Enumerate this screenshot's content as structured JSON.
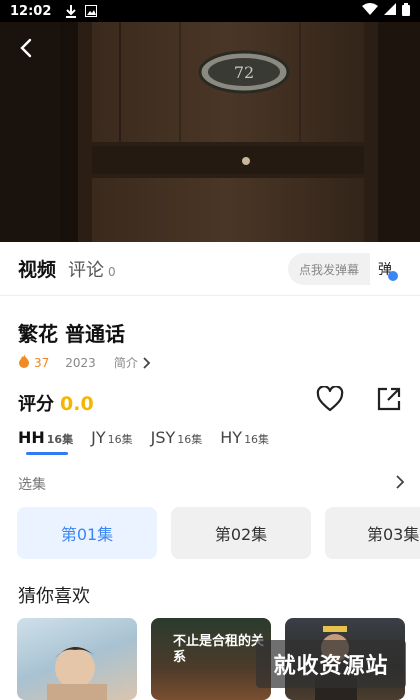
{
  "status_bar": {
    "time": "12:02"
  },
  "video": {
    "door_number": "72"
  },
  "tabs": {
    "video_label": "视频",
    "comments_label": "评论",
    "comments_count": "0",
    "danmu_placeholder": "点我发弹幕",
    "danmu_toggle_label": "弹"
  },
  "title": "繁花 普通话",
  "meta": {
    "heat": "37",
    "year": "2023",
    "intro_label": "简介"
  },
  "rating": {
    "label": "评分",
    "score": "0.0"
  },
  "sources": [
    {
      "name": "HH",
      "eps": "16集"
    },
    {
      "name": "JY",
      "eps": "16集"
    },
    {
      "name": "JSY",
      "eps": "16集"
    },
    {
      "name": "HY",
      "eps": "16集"
    }
  ],
  "episodes_title": "选集",
  "episodes": [
    "第01集",
    "第02集",
    "第03集"
  ],
  "guess_title": "猜你喜欢",
  "recommendations": [
    {
      "poster_text": ""
    },
    {
      "poster_text": "不止是合租的关系"
    },
    {
      "poster_text": ""
    }
  ],
  "watermark": "就收资源站",
  "colors": {
    "accent": "#3a86f5",
    "score": "#f7b500",
    "heat": "#f08a24"
  }
}
